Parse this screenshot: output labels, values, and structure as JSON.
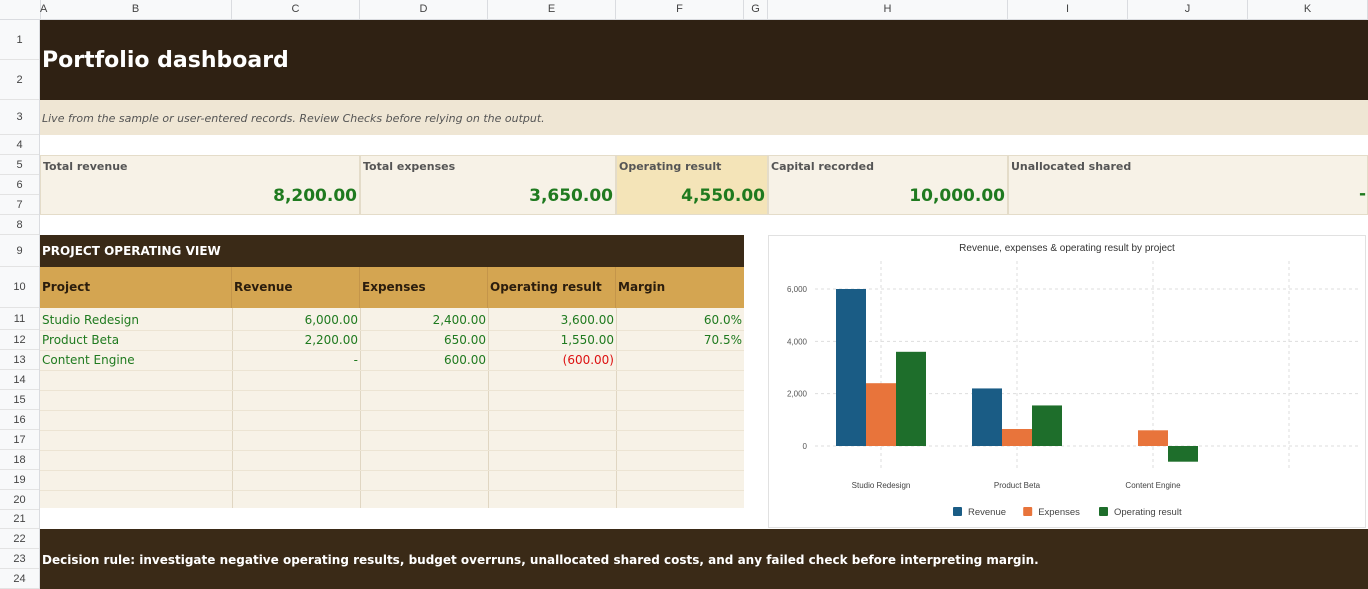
{
  "columns": [
    "A",
    "B",
    "C",
    "D",
    "E",
    "F",
    "G",
    "H",
    "I",
    "J",
    "K"
  ],
  "rows": [
    "1",
    "2",
    "3",
    "4",
    "5",
    "6",
    "7",
    "8",
    "9",
    "10",
    "11",
    "12",
    "13",
    "14",
    "15",
    "16",
    "17",
    "18",
    "19",
    "20",
    "21",
    "22",
    "23",
    "24"
  ],
  "title": "Portfolio dashboard",
  "subtitle": "Live from the sample or user-entered records. Review Checks before relying on the output.",
  "kpis": [
    {
      "label": "Total revenue",
      "value": "8,200.00"
    },
    {
      "label": "Total expenses",
      "value": "3,650.00"
    },
    {
      "label": "Operating result",
      "value": "4,550.00"
    },
    {
      "label": "Capital recorded",
      "value": "10,000.00"
    },
    {
      "label": "Unallocated shared",
      "value": "-"
    }
  ],
  "section_title": "PROJECT OPERATING VIEW",
  "table": {
    "headers": [
      "Project",
      "Revenue",
      "Expenses",
      "Operating result",
      "Margin"
    ],
    "rows": [
      [
        "Studio Redesign",
        "6,000.00",
        "2,400.00",
        "3,600.00",
        "60.0%"
      ],
      [
        "Product Beta",
        "2,200.00",
        "650.00",
        "1,550.00",
        "70.5%"
      ],
      [
        "Content Engine",
        "-",
        "600.00",
        "(600.00)",
        ""
      ]
    ]
  },
  "footer": "Decision rule: investigate negative operating results, budget overruns, unallocated shared costs, and any failed check before interpreting margin.",
  "chart_data": {
    "type": "bar",
    "title": "Revenue, expenses & operating result by project",
    "categories": [
      "Studio Redesign",
      "Product Beta",
      "Content Engine"
    ],
    "series": [
      {
        "name": "Revenue",
        "values": [
          6000,
          2200,
          0
        ],
        "color": "#1a5c85"
      },
      {
        "name": "Expenses",
        "values": [
          2400,
          650,
          600
        ],
        "color": "#e8743b"
      },
      {
        "name": "Operating result",
        "values": [
          3600,
          1550,
          -600
        ],
        "color": "#1e6e2b"
      }
    ],
    "yticks": [
      "0",
      "2,000",
      "4,000",
      "6,000"
    ],
    "ylim": [
      -600,
      6000
    ],
    "grid": true,
    "legend": "bottom"
  }
}
